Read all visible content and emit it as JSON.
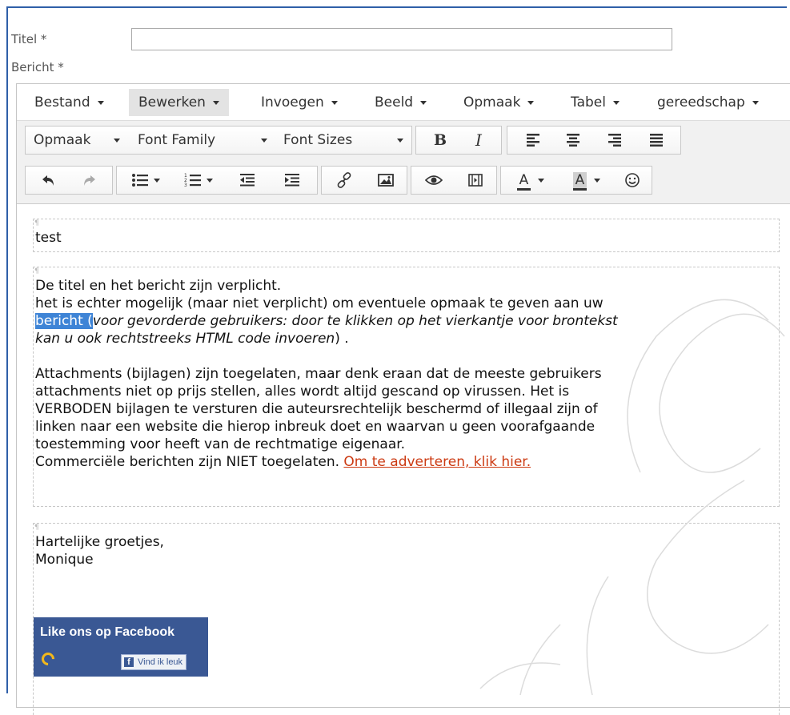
{
  "form": {
    "title_label": "Titel *",
    "message_label": "Bericht *",
    "title_value": ""
  },
  "menubar": {
    "items": [
      "Bestand",
      "Bewerken",
      "Invoegen",
      "Beeld",
      "Opmaak",
      "Tabel",
      "gereedschap"
    ],
    "active": "Bewerken"
  },
  "toolbar": {
    "format_dropdown": "Opmaak",
    "font_family": "Font Family",
    "font_sizes": "Font Sizes",
    "bold": "B",
    "italic": "I",
    "text_color": "A",
    "bg_color": "A",
    "icons": [
      "undo-icon",
      "redo-icon",
      "bullet-list-icon",
      "numbered-list-icon",
      "outdent-icon",
      "indent-icon",
      "link-icon",
      "image-icon",
      "preview-icon",
      "media-icon",
      "emoticon-icon",
      "align-left-icon",
      "align-center-icon",
      "align-right-icon",
      "align-justify-icon"
    ]
  },
  "content": {
    "block1": "test",
    "block2": {
      "line1": "De titel en het bericht zijn verplicht.",
      "line2": "het is echter mogelijk (maar niet verplicht) om eventuele opmaak te geven aan uw",
      "selected": "bericht (",
      "italic1": "voor gevorderde gebruikers: door te klikken op het vierkantje voor brontekst",
      "italic2": "kan u ook rechtstreeks HTML code invoeren",
      "tail": ") .",
      "para2_l1": "Attachments (bijlagen) zijn toegelaten, maar denk eraan dat de meeste gebruikers",
      "para2_l2": "attachments niet op prijs stellen, alles wordt altijd gescand op virussen. Het is",
      "para2_l3": "VERBODEN bijlagen te versturen die auteursrechtelijk beschermd of illegaal zijn of",
      "para2_l4": "linken naar een website die hierop inbreuk doet en waarvan u geen voorafgaande",
      "para2_l5": "toestemming voor heeft van de rechtmatige eigenaar.",
      "para2_l6": "Commerciële berichten zijn NIET toegelaten.",
      "link": "Om te adverteren, klik hier."
    },
    "block3": {
      "greeting": "Hartelijke groetjes,",
      "name": "Monique"
    },
    "facebook": {
      "title": "Like ons op Facebook",
      "button": "Vind ik leuk"
    }
  },
  "colors": {
    "frame": "#2f5fa8",
    "selection": "#3e84d6",
    "link": "#cc3a12",
    "facebook": "#3a5894"
  }
}
